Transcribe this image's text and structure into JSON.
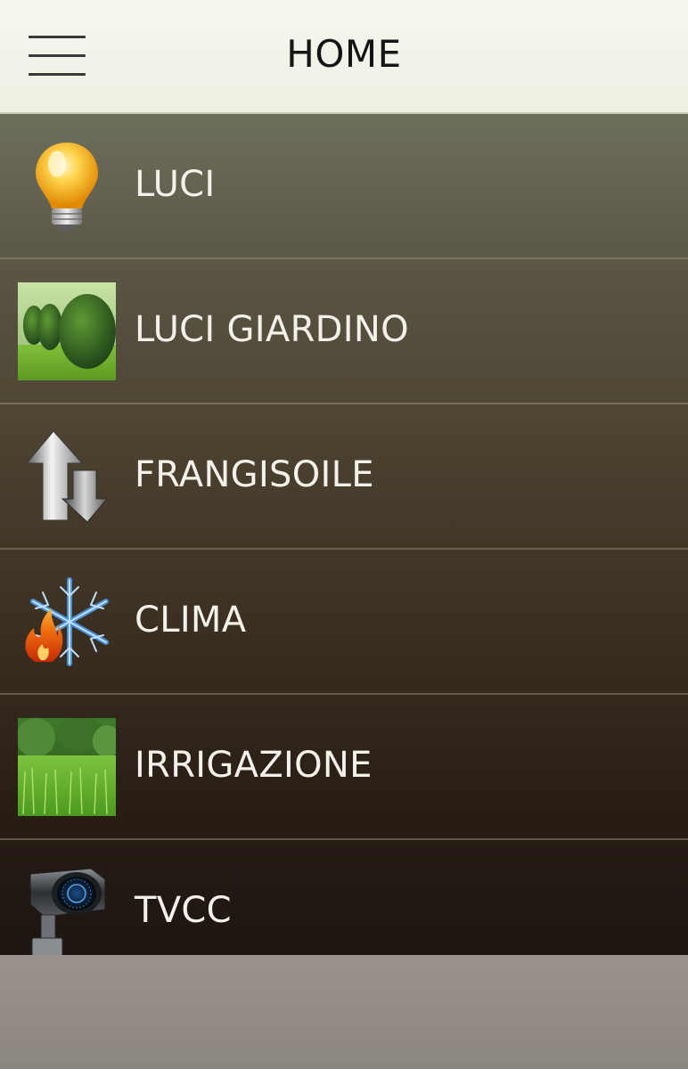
{
  "header": {
    "title": "HOME",
    "menu_icon": "hamburger-icon"
  },
  "menu": {
    "items": [
      {
        "label": "LUCI",
        "icon": "lightbulb-icon"
      },
      {
        "label": "LUCI GIARDINO",
        "icon": "garden-hedge-icon"
      },
      {
        "label": "FRANGISOILE",
        "icon": "up-down-arrows-icon"
      },
      {
        "label": "CLIMA",
        "icon": "flame-snowflake-icon"
      },
      {
        "label": "IRRIGAZIONE",
        "icon": "lawn-grass-icon"
      },
      {
        "label": "TVCC",
        "icon": "security-camera-icon"
      }
    ]
  }
}
